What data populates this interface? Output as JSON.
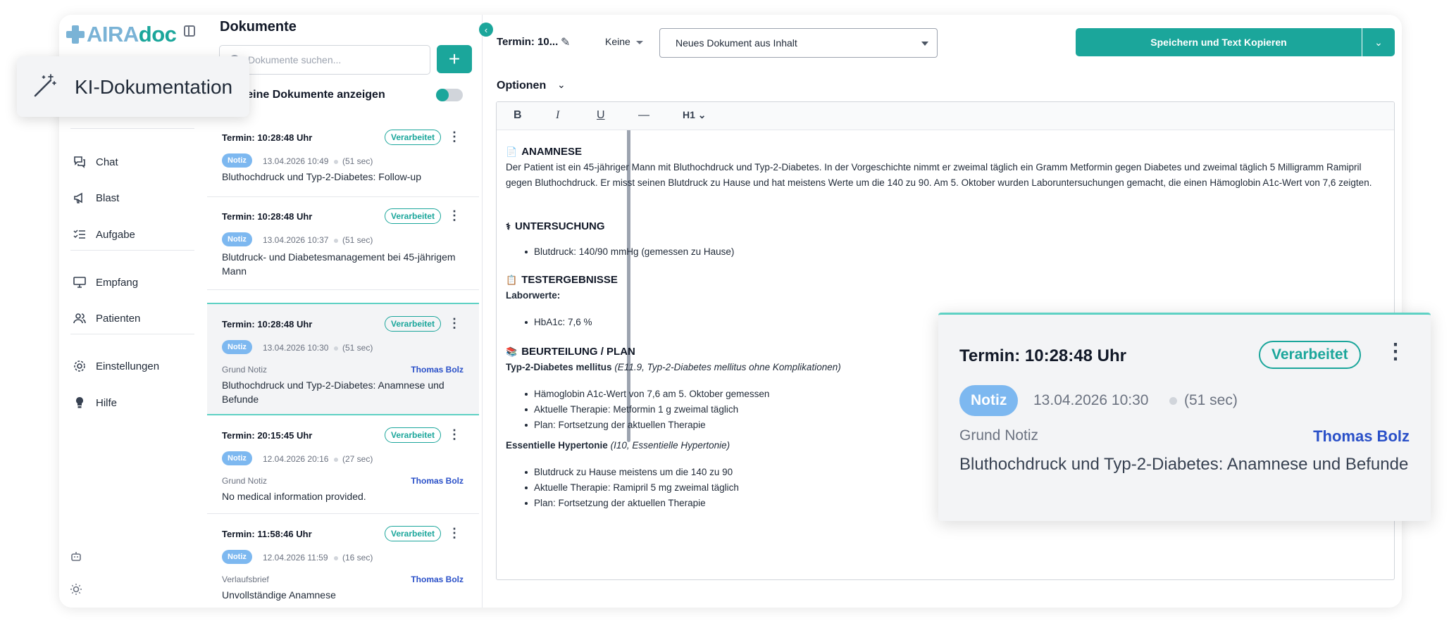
{
  "brand": {
    "part1": "AIRA",
    "part2": "doc"
  },
  "nav": [
    {
      "label": "Chat",
      "icon": "chat-icon"
    },
    {
      "label": "Blast",
      "icon": "megaphone-icon"
    },
    {
      "label": "Aufgabe",
      "icon": "task-list-icon"
    },
    {
      "label": "Empfang",
      "icon": "monitor-icon"
    },
    {
      "label": "Patienten",
      "icon": "users-icon"
    },
    {
      "label": "Einstellungen",
      "icon": "gear-icon"
    },
    {
      "label": "Hilfe",
      "icon": "lightbulb-icon"
    }
  ],
  "ki_popup": {
    "label": "KI-Dokumentation"
  },
  "doclist": {
    "title": "Dokumente",
    "search_placeholder": "Dokumente suchen...",
    "add_label": "+",
    "toggle_label": "meine Dokumente anzeigen",
    "cards": [
      {
        "title": "Termin: 10:28:48 Uhr",
        "status": "Verarbeitet",
        "type": "Notiz",
        "date": "13.04.2026 10:49",
        "duration": "(51 sec)",
        "grund": "",
        "author": "",
        "text": "Bluthochdruck und Typ-2-Diabetes: Follow-up"
      },
      {
        "title": "Termin: 10:28:48 Uhr",
        "status": "Verarbeitet",
        "type": "Notiz",
        "date": "13.04.2026 10:37",
        "duration": "(51 sec)",
        "grund": "",
        "author": "",
        "text": "Blutdruck- und Diabetesmanagement bei 45-jährigem Mann"
      },
      {
        "title": "Termin: 10:28:48 Uhr",
        "status": "Verarbeitet",
        "type": "Notiz",
        "date": "13.04.2026 10:30",
        "duration": "(51 sec)",
        "grund": "Grund Notiz",
        "author": "Thomas Bolz",
        "text": "Bluthochdruck und Typ-2-Diabetes: Anamnese und Befunde"
      },
      {
        "title": "Termin: 20:15:45 Uhr",
        "status": "Verarbeitet",
        "type": "Notiz",
        "date": "12.04.2026 20:16",
        "duration": "(27 sec)",
        "grund": "Grund Notiz",
        "author": "Thomas Bolz",
        "text": "No medical information provided."
      },
      {
        "title": "Termin: 11:58:46 Uhr",
        "status": "Verarbeitet",
        "type": "Notiz",
        "date": "12.04.2026 11:59",
        "duration": "(16 sec)",
        "grund": "Verlaufsbrief",
        "author": "Thomas Bolz",
        "text": "Unvollständige Anamnese"
      }
    ]
  },
  "editor": {
    "title": "Termin: 10...",
    "category": "Keine",
    "template_select": "Neues Dokument aus Inhalt",
    "save_label": "Speichern und Text Kopieren",
    "options_label": "Optionen",
    "toolbar": {
      "bold": "B",
      "italic": "I",
      "underline": "U",
      "hr": "—",
      "heading": "H1"
    },
    "sections": {
      "anamnese_title": "ANAMNESE",
      "anamnese_text": "Der Patient ist ein 45-jähriger Mann mit Bluthochdruck und Typ-2-Diabetes. In der Vorgeschichte nimmt er zweimal täglich ein Gramm Metformin gegen Diabetes und zweimal täglich 5 Milligramm Ramipril gegen Bluthochdruck. Er misst seinen Blutdruck zu Hause und hat meistens Werte um die 140 zu 90. Am 5. Oktober wurden Laboruntersuchungen gemacht, die einen Hämoglobin A1c-Wert von 7,6 zeigten.",
      "untersuchung_title": "UNTERSUCHUNG",
      "untersuchung_items": [
        "Blutdruck: 140/90 mmHg (gemessen zu Hause)"
      ],
      "test_title": "TESTERGEBNISSE",
      "test_sub": "Laborwerte:",
      "test_items": [
        "HbA1c: 7,6 %"
      ],
      "plan_title": "BEURTEILUNG / PLAN",
      "diag1_name": "Typ-2-Diabetes mellitus",
      "diag1_code": "(E11.9, Typ-2-Diabetes mellitus ohne Komplikationen)",
      "diag1_items": [
        "Hämoglobin A1c-Wert von 7,6 am 5. Oktober gemessen",
        "Aktuelle Therapie: Metformin 1 g zweimal täglich",
        "Plan: Fortsetzung der aktuellen Therapie"
      ],
      "diag2_name": "Essentielle Hypertonie",
      "diag2_code": "(I10, Essentielle Hypertonie)",
      "diag2_items": [
        "Blutdruck zu Hause meistens um die 140 zu 90",
        "Aktuelle Therapie: Ramipril 5 mg zweimal täglich",
        "Plan: Fortsetzung der aktuellen Therapie"
      ]
    }
  },
  "zoom_card": {
    "title": "Termin: 10:28:48 Uhr",
    "status": "Verarbeitet",
    "type": "Notiz",
    "date": "13.04.2026 10:30",
    "duration": "(51 sec)",
    "grund": "Grund Notiz",
    "author": "Thomas Bolz",
    "text": "Bluthochdruck und Typ-2-Diabetes: Anamnese und Befunde"
  },
  "colors": {
    "accent": "#1ba69b",
    "notiz": "#7db8f0",
    "author": "#2a50c8",
    "logo_light": "#7ab3d6"
  }
}
